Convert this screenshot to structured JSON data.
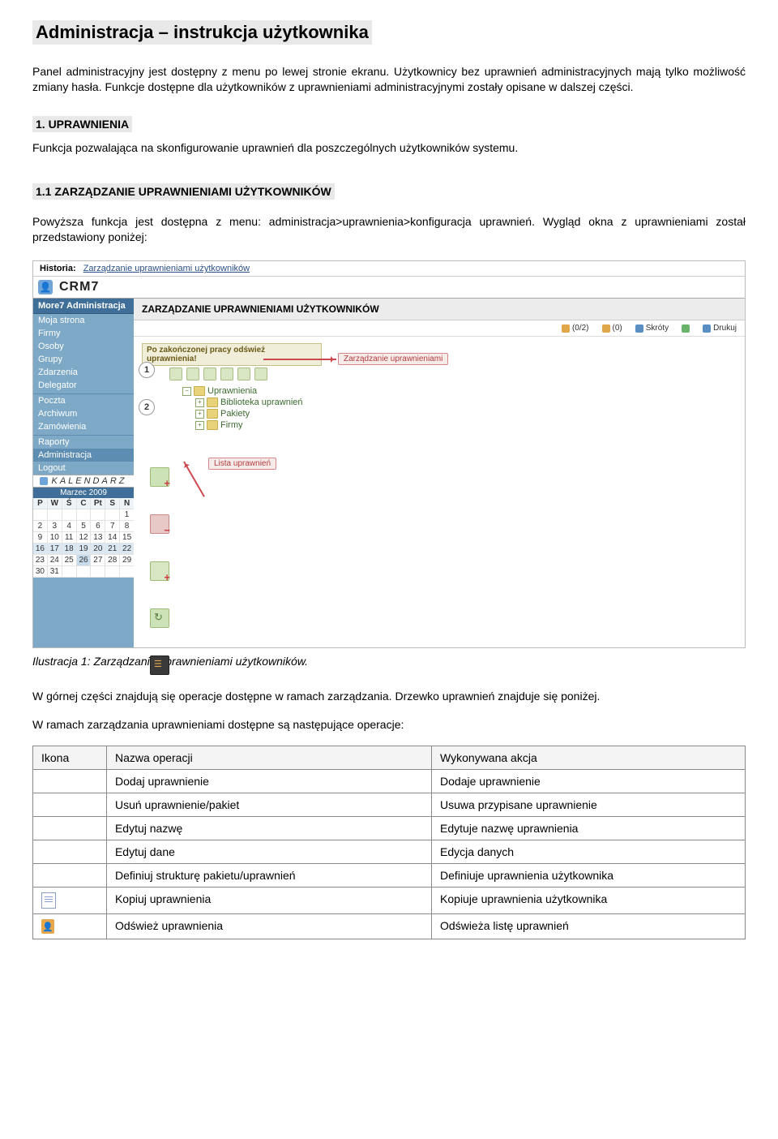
{
  "doc": {
    "title": "Administracja – instrukcja użytkownika",
    "intro": "Panel administracyjny jest dostępny z menu po lewej stronie ekranu. Użytkownicy bez uprawnień administracyjnych mają tylko możliwość zmiany hasła. Funkcje dostępne dla użytkowników z uprawnieniami administracyjnymi zostały opisane w dalszej części.",
    "s1_title": "1. UPRAWNIENIA",
    "s1_text": "Funkcja pozwalająca na skonfigurowanie uprawnień dla poszczególnych użytkowników systemu.",
    "s11_title": "1.1 ZARZĄDZANIE UPRAWNIENIAMI UŻYTKOWNIKÓW",
    "s11_text": "Powyższa funkcja jest dostępna z menu: administracja>uprawnienia>konfiguracja uprawnień. Wygląd okna z uprawnieniami został przedstawiony poniżej:",
    "caption": "Ilustracja 1: Zarządzanie uprawnieniami użytkowników.",
    "after1": "W górnej części znajdują się  operacje dostępne w ramach zarządzania. Drzewko uprawnień znajduje się poniżej.",
    "after2": "W ramach zarządzania uprawnieniami dostępne są następujące operacje:"
  },
  "app": {
    "historia_label": "Historia:",
    "historia_value": "Zarządzanie uprawnieniami użytkowników",
    "brand": "CRM7",
    "side_header": "More7 Administracja",
    "side_items": [
      "Moja strona",
      "Firmy",
      "Osoby",
      "Grupy",
      "Zdarzenia",
      "Delegator",
      "Poczta",
      "Archiwum",
      "Zamówienia",
      "Raporty",
      "Administracja",
      "Logout"
    ],
    "kalendarz": {
      "title": "KALENDARZ",
      "month": "Marzec 2009",
      "dow": [
        "P",
        "W",
        "Ś",
        "C",
        "Pt",
        "S",
        "N"
      ],
      "rows": [
        [
          "",
          "",
          "",
          "",
          "",
          "",
          "1"
        ],
        [
          "2",
          "3",
          "4",
          "5",
          "6",
          "7",
          "8"
        ],
        [
          "9",
          "10",
          "11",
          "12",
          "13",
          "14",
          "15"
        ],
        [
          "16",
          "17",
          "18",
          "19",
          "20",
          "21",
          "22"
        ],
        [
          "23",
          "24",
          "25",
          "26",
          "27",
          "28",
          "29"
        ],
        [
          "30",
          "31",
          "",
          "",
          "",
          "",
          ""
        ]
      ]
    },
    "main_title": "ZARZĄDZANIE UPRAWNIENIAMI UŻYTKOWNIKÓW",
    "toolbar_right": {
      "count1": "(0/2)",
      "count2": "(0)",
      "skroty": "Skróty",
      "drukuj": "Drukuj"
    },
    "notice": "Po zakończonej pracy odśwież uprawnienia!",
    "callouts": {
      "c1": "Zarządzanie uprawnieniami",
      "c2": "Lista uprawnień",
      "n1": "1",
      "n2": "2"
    },
    "tree": {
      "root": "Uprawnienia",
      "children": [
        "Biblioteka uprawnień",
        "Pakiety",
        "Firmy"
      ]
    }
  },
  "table": {
    "headers": [
      "Ikona",
      "Nazwa operacji",
      "Wykonywana akcja"
    ],
    "rows": [
      {
        "op": "Dodaj uprawnienie",
        "act": "Dodaje uprawnienie"
      },
      {
        "op": "Usuń uprawnienie/pakiet",
        "act": "Usuwa przypisane uprawnienie"
      },
      {
        "op": "Edytuj nazwę",
        "act": "Edytuje nazwę uprawnienia"
      },
      {
        "op": "Edytuj dane",
        "act": "Edycja danych"
      },
      {
        "op": "Definiuj strukturę pakietu/uprawnień",
        "act": "Definiuje uprawnienia użytkownika"
      },
      {
        "op": "Kopiuj uprawnienia",
        "act": "Kopiuje uprawnienia użytkownika",
        "icon": "doc"
      },
      {
        "op": "Odśwież uprawnienia",
        "act": "Odświeża listę uprawnień",
        "icon": "refresh-person"
      }
    ]
  }
}
